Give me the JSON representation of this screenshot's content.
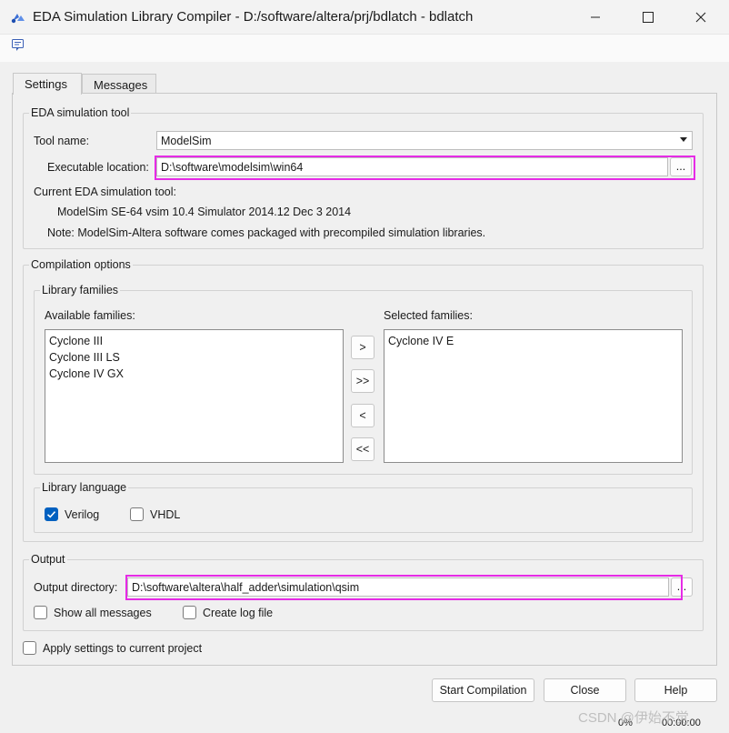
{
  "window": {
    "title": "EDA Simulation Library Compiler - D:/software/altera/prj/bdlatch - bdlatch"
  },
  "tabs": [
    {
      "label": "Settings",
      "active": true
    },
    {
      "label": "Messages",
      "active": false
    }
  ],
  "eda_tool": {
    "group_title": "EDA simulation tool",
    "tool_name_label": "Tool name:",
    "tool_name_value": "ModelSim",
    "exec_label": "Executable location:",
    "exec_value": "D:\\software\\modelsim\\win64",
    "browse_label": "...",
    "current_label": "Current EDA simulation tool:",
    "current_value": "ModelSim SE-64 vsim 10.4 Simulator 2014.12 Dec  3 2014",
    "note": "Note: ModelSim-Altera software comes packaged with precompiled simulation libraries."
  },
  "compilation": {
    "group_title": "Compilation options",
    "families_group_title": "Library families",
    "available_label": "Available families:",
    "available": [
      "Cyclone III",
      "Cyclone III LS",
      "Cyclone IV GX"
    ],
    "selected_label": "Selected families:",
    "selected": [
      "Cyclone IV E"
    ],
    "move_buttons": [
      ">",
      ">>",
      "<",
      "<<"
    ],
    "language_group_title": "Library language",
    "verilog_label": "Verilog",
    "verilog_checked": true,
    "vhdl_label": "VHDL",
    "vhdl_checked": false
  },
  "output": {
    "group_title": "Output",
    "dir_label": "Output directory:",
    "dir_value": "D:\\software\\altera\\half_adder\\simulation\\qsim",
    "browse_label": "...",
    "show_all_label": "Show all messages",
    "show_all_checked": false,
    "create_log_label": "Create log file",
    "create_log_checked": false
  },
  "apply_label": "Apply settings to current project",
  "apply_checked": false,
  "buttons": {
    "start": "Start Compilation",
    "close": "Close",
    "help": "Help"
  },
  "status": {
    "progress": "0%",
    "elapsed": "00:00:00",
    "watermark": "CSDN @伊始不觉"
  },
  "colors": {
    "highlight": "#e62be6",
    "checkbox_checked": "#0060c0"
  }
}
